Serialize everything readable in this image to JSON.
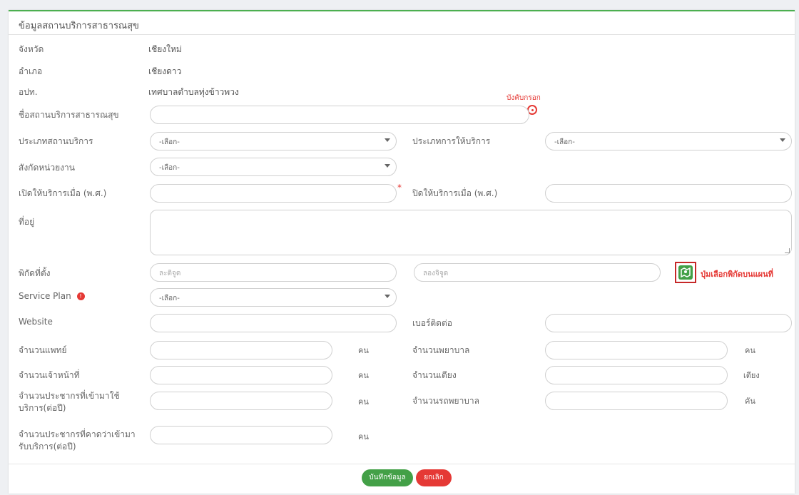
{
  "section_title": "ข้อมูลสถานบริการสาธารณสุข",
  "info": {
    "province_label": "จังหวัด",
    "province_value": "เชียงใหม่",
    "district_label": "อำเภอ",
    "district_value": "เชียงดาว",
    "lao_label": "อปท.",
    "lao_value": "เทศบาลตำบลทุ่งข้าวพวง"
  },
  "annotations": {
    "required_note": "บังคับกรอก",
    "map_button_note": "ปุ่มเลือกพิกัดบนแผนที่"
  },
  "form": {
    "facility_name_label": "ชื่อสถานบริการสาธารณสุข",
    "facility_type_label": "ประเภทสถานบริการ",
    "facility_type_value": "-เลือก-",
    "service_type_label": "ประเภทการให้บริการ",
    "service_type_value": "-เลือก-",
    "affiliation_label": "สังกัดหน่วยงาน",
    "affiliation_value": "-เลือก-",
    "open_year_label": "เปิดให้บริการเมื่อ (พ.ศ.)",
    "close_year_label": "ปิดให้บริการเมื่อ (พ.ศ.)",
    "address_label": "ที่อยู่",
    "coords_label": "พิกัดที่ตั้ง",
    "lat_placeholder": "ละติจูด",
    "lon_placeholder": "ลองจิจูด",
    "service_plan_label": "Service Plan",
    "service_plan_value": "-เลือก-",
    "website_label": "Website",
    "phone_label": "เบอร์ติดต่อ",
    "doctors_label": "จำนวนแพทย์",
    "doctors_unit": "คน",
    "nurses_label": "จำนวนพยาบาล",
    "nurses_unit": "คน",
    "staff_label": "จำนวนเจ้าหน้าที่",
    "staff_unit": "คน",
    "beds_label": "จำนวนเตียง",
    "beds_unit": "เตียง",
    "population_label_1": "จำนวนประชากรที่เข้ามาใช้",
    "population_label_2": "บริการ(ต่อปี)",
    "population_unit": "คน",
    "ambulance_label": "จำนวนรถพยาบาล",
    "ambulance_unit": "คัน",
    "expected_label_1": "จำนวนประชากรที่คาดว่าเข้ามา",
    "expected_label_2": "รับบริการ(ต่อปี)",
    "expected_unit": "คน"
  },
  "buttons": {
    "save": "บันทึกข้อมูล",
    "cancel": "ยกเลิก"
  },
  "colors": {
    "accent_green": "#4caf50",
    "save_green": "#43a047",
    "cancel_red": "#e53935",
    "annotation_red": "#e53935"
  }
}
